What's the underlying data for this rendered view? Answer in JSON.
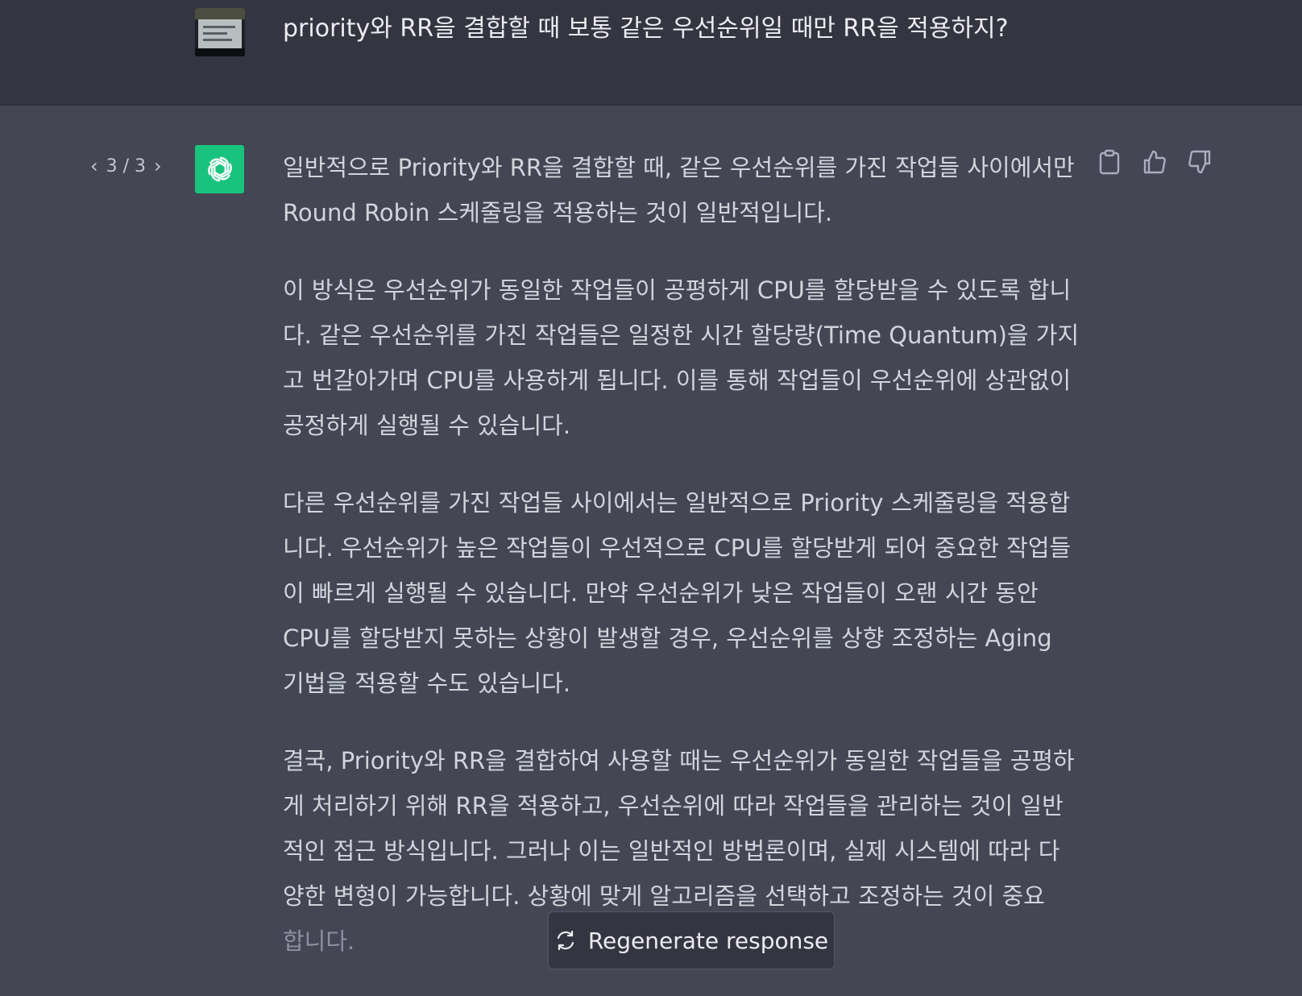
{
  "user_message": {
    "text": "priority와 RR을 결합할 때 보통 같은 우선순위일 때만 RR을 적용하지?"
  },
  "pager": {
    "label": "3 / 3"
  },
  "answer": {
    "paragraphs": [
      "일반적으로 Priority와 RR을 결합할 때, 같은 우선순위를 가진 작업들 사이에서만 Round Robin 스케줄링을 적용하는 것이 일반적입니다.",
      "이 방식은 우선순위가 동일한 작업들이 공평하게 CPU를 할당받을 수 있도록 합니다. 같은 우선순위를 가진 작업들은 일정한 시간 할당량(Time Quantum)을 가지고 번갈아가며 CPU를 사용하게 됩니다. 이를 통해 작업들이 우선순위에 상관없이 공정하게 실행될 수 있습니다.",
      "다른 우선순위를 가진 작업들 사이에서는 일반적으로 Priority 스케줄링을 적용합니다. 우선순위가 높은 작업들이 우선적으로 CPU를 할당받게 되어 중요한 작업들이 빠르게 실행될 수 있습니다. 만약 우선순위가 낮은 작업들이 오랜 시간 동안 CPU를 할당받지 못하는 상황이 발생할 경우, 우선순위를 상향 조정하는 Aging 기법을 적용할 수도 있습니다.",
      "결국, Priority와 RR을 결합하여 사용할 때는 우선순위가 동일한 작업들을 공평하게 처리하기 위해 RR을 적용하고, 우선순위에 따라 작업들을 관리하는 것이 일반적인 접근 방식입니다. 그러나 이는 일반적인 방법론이며, 실제 시스템에 따라 다양한 변형이 가능합니다. 상황에 맞게 알고리즘을 선택하고 조정하는 것이 중요",
      "합니다."
    ]
  },
  "regenerate": {
    "label": "Regenerate response"
  },
  "colors": {
    "user_bg": "#343541",
    "assistant_bg": "#444654",
    "avatar_green": "#19c37d"
  },
  "icons": {
    "copy": "clipboard-icon",
    "like": "thumbs-up-icon",
    "dislike": "thumbs-down-icon",
    "regen": "refresh-icon"
  }
}
